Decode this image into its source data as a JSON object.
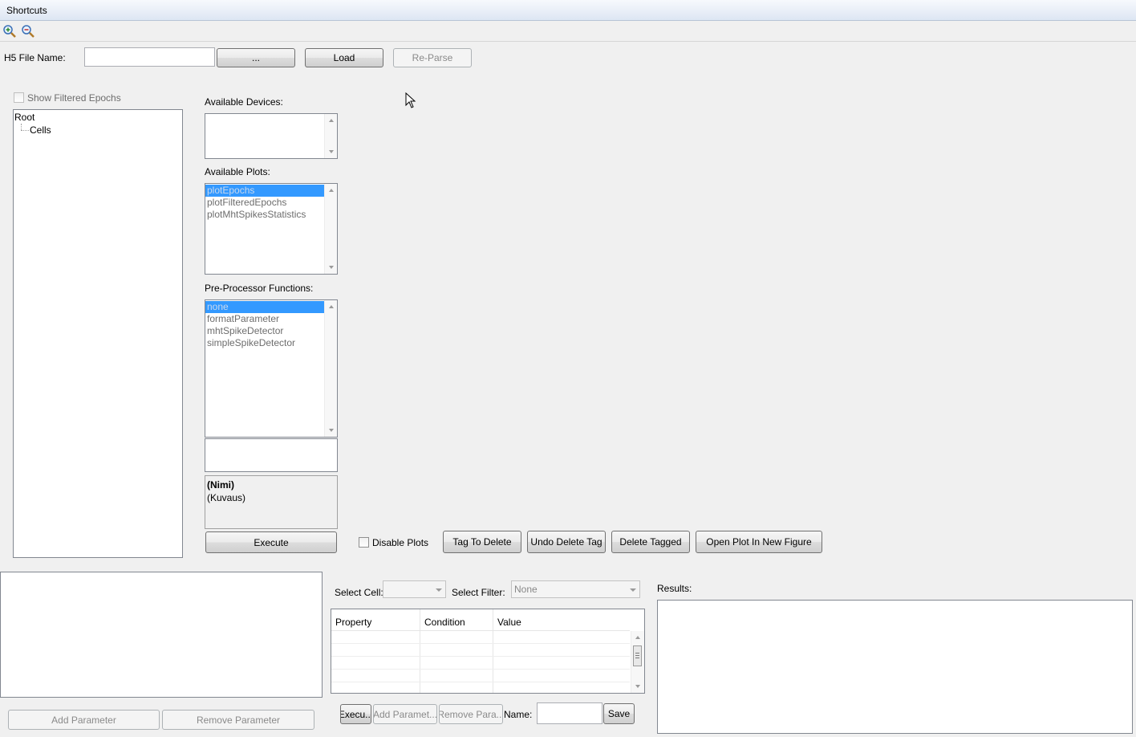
{
  "menubar": {
    "label": "Shortcuts"
  },
  "toolbar": {
    "zoom_in": "zoom-in-icon",
    "zoom_out": "zoom-out-icon"
  },
  "file": {
    "label": "H5 File Name:",
    "value": "",
    "browse_label": "...",
    "load_label": "Load",
    "reparse_label": "Re-Parse"
  },
  "tree": {
    "show_filtered_label": "Show Filtered Epochs",
    "root_label": "Root",
    "child_label": "Cells"
  },
  "devices": {
    "label": "Available Devices:",
    "items": []
  },
  "plots": {
    "label": "Available Plots:",
    "items": [
      "plotEpochs",
      "plotFilteredEpochs",
      "plotMhtSpikesStatistics"
    ],
    "selected": "plotEpochs"
  },
  "preproc": {
    "label": "Pre-Processor Functions:",
    "items": [
      "none",
      "formatParameter",
      "mhtSpikeDetector",
      "simpleSpikeDetector"
    ],
    "selected": "none"
  },
  "info": {
    "name": "(Nimi)",
    "description": "(Kuvaus)"
  },
  "actions": {
    "execute_label": "Execute",
    "disable_plots_label": "Disable Plots",
    "tag_delete_label": "Tag To Delete",
    "undo_tag_label": "Undo Delete Tag",
    "delete_tagged_label": "Delete Tagged",
    "open_plot_label": "Open Plot In New Figure"
  },
  "params": {
    "add_label": "Add Parameter",
    "remove_label": "Remove Parameter"
  },
  "filter": {
    "select_cell_label": "Select Cell:",
    "select_cell_value": "",
    "select_filter_label": "Select Filter:",
    "select_filter_value": "None",
    "columns": [
      "Property",
      "Condition",
      "Value"
    ],
    "execute_label": "Execu...",
    "add_label": "Add Paramet...",
    "remove_label": "Remove Para...",
    "name_label": "Name:",
    "name_value": "",
    "save_label": "Save"
  },
  "results": {
    "label": "Results:"
  }
}
